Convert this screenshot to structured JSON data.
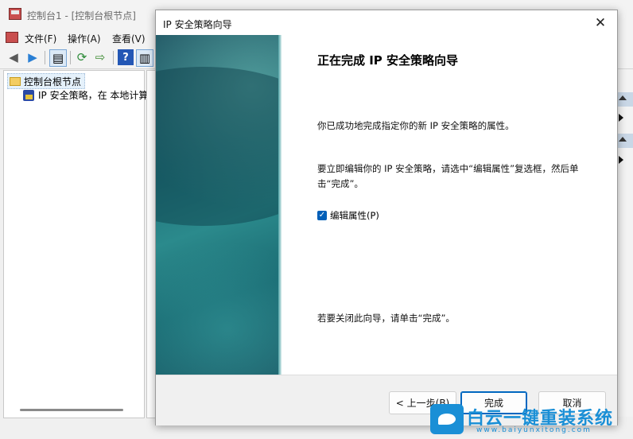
{
  "mmc": {
    "title": "控制台1 - [控制台根节点]",
    "menu": [
      "文件(F)",
      "操作(A)",
      "查看(V)"
    ],
    "tree": {
      "root": "控制台根节点",
      "child": "IP 安全策略，在 本地计算机"
    }
  },
  "wizard": {
    "title": "IP 安全策略向导",
    "close_glyph": "✕",
    "heading": "正在完成 IP 安全策略向导",
    "para1": "你已成功地完成指定你的新 IP 安全策略的属性。",
    "para2": "要立即编辑你的 IP 安全策略，请选中“编辑属性”复选框，然后单击“完成”。",
    "checkbox_label": "编辑属性(P)",
    "checkbox_checked": true,
    "para3": "若要关闭此向导，请单击“完成”。",
    "buttons": {
      "back": "< 上一步(B)",
      "finish": "完成",
      "cancel": "取消"
    }
  },
  "watermark": {
    "text": "白云一键重装系统",
    "url": "www.baiyunxitong.com"
  },
  "colors": {
    "accent": "#005fb8",
    "banner": "#1f6f78",
    "watermark": "#1a8fd6"
  }
}
